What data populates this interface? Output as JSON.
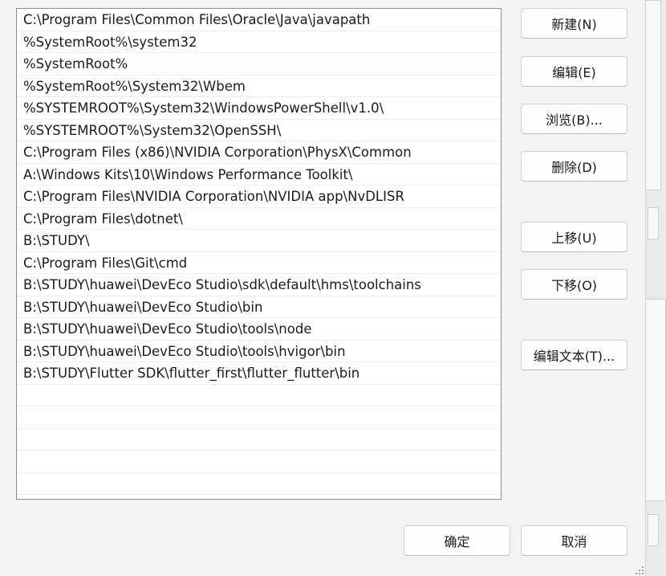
{
  "path_entries": [
    "C:\\Program Files\\Common Files\\Oracle\\Java\\javapath",
    "%SystemRoot%\\system32",
    "%SystemRoot%",
    "%SystemRoot%\\System32\\Wbem",
    "%SYSTEMROOT%\\System32\\WindowsPowerShell\\v1.0\\",
    "%SYSTEMROOT%\\System32\\OpenSSH\\",
    "C:\\Program Files (x86)\\NVIDIA Corporation\\PhysX\\Common",
    "A:\\Windows Kits\\10\\Windows Performance Toolkit\\",
    "C:\\Program Files\\NVIDIA Corporation\\NVIDIA app\\NvDLISR",
    "C:\\Program Files\\dotnet\\",
    "B:\\STUDY\\",
    "C:\\Program Files\\Git\\cmd",
    "B:\\STUDY\\huawei\\DevEco Studio\\sdk\\default\\hms\\toolchains",
    "B:\\STUDY\\huawei\\DevEco Studio\\bin",
    "B:\\STUDY\\huawei\\DevEco Studio\\tools\\node",
    "B:\\STUDY\\huawei\\DevEco Studio\\tools\\hvigor\\bin",
    "B:\\STUDY\\Flutter SDK\\flutter_first\\flutter_flutter\\bin",
    "",
    "",
    "",
    "",
    ""
  ],
  "buttons": {
    "new": "新建(N)",
    "edit": "编辑(E)",
    "browse": "浏览(B)...",
    "delete": "删除(D)",
    "move_up": "上移(U)",
    "move_down": "下移(O)",
    "edit_text": "编辑文本(T)...",
    "ok": "确定",
    "cancel": "取消"
  }
}
